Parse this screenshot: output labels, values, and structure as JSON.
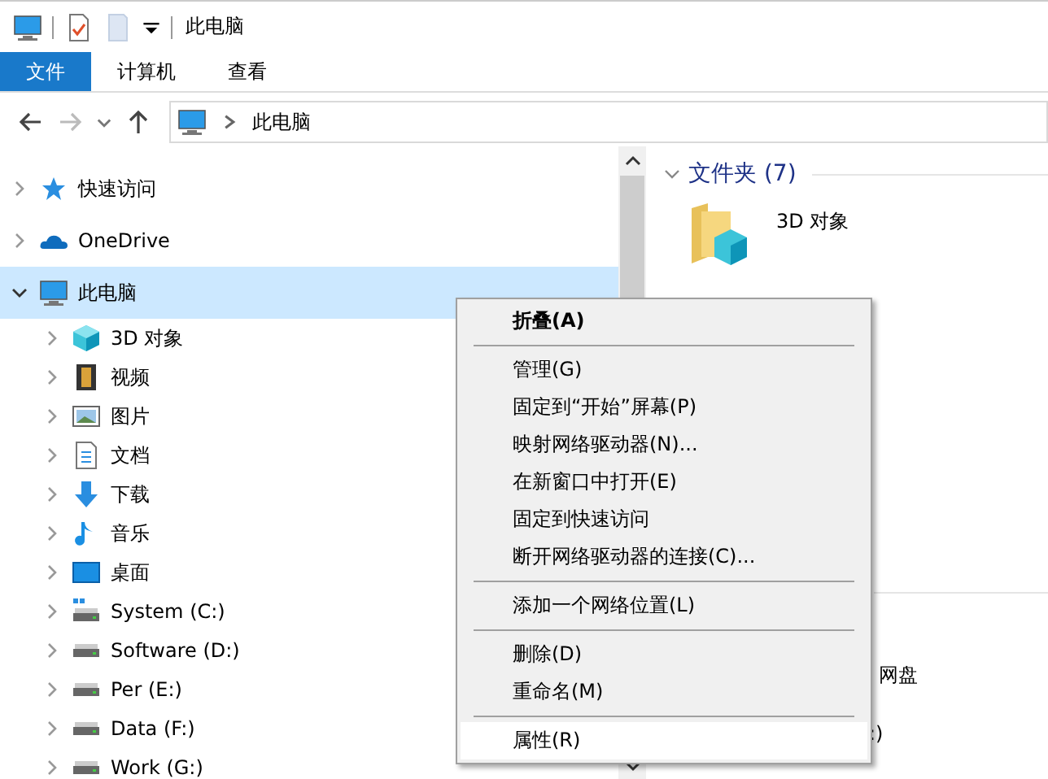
{
  "window": {
    "title": "此电脑"
  },
  "ribbon_tabs": [
    {
      "label": "文件",
      "selected": true
    },
    {
      "label": "计算机",
      "selected": false
    },
    {
      "label": "查看",
      "selected": false
    }
  ],
  "address": {
    "path": "此电脑"
  },
  "nav_tree": [
    {
      "label": "快速访问",
      "kind": "star",
      "expanded": false,
      "selected": false
    },
    {
      "label": "OneDrive",
      "kind": "cloud",
      "expanded": false,
      "selected": false
    },
    {
      "label": "此电脑",
      "kind": "pc",
      "expanded": true,
      "selected": true,
      "children": [
        {
          "label": "3D 对象",
          "kind": "cube",
          "expanded": false,
          "selected": false
        },
        {
          "label": "视频",
          "kind": "film",
          "expanded": false,
          "selected": false
        },
        {
          "label": "图片",
          "kind": "image",
          "expanded": false,
          "selected": false
        },
        {
          "label": "文档",
          "kind": "doc",
          "expanded": false,
          "selected": false
        },
        {
          "label": "下载",
          "kind": "download",
          "expanded": false,
          "selected": false
        },
        {
          "label": "音乐",
          "kind": "music",
          "expanded": false,
          "selected": false
        },
        {
          "label": "桌面",
          "kind": "desktop",
          "expanded": false,
          "selected": false
        },
        {
          "label": "System (C:)",
          "kind": "sysdrive",
          "expanded": false,
          "selected": false
        },
        {
          "label": "Software (D:)",
          "kind": "drive",
          "expanded": false,
          "selected": false
        },
        {
          "label": "Per (E:)",
          "kind": "drive",
          "expanded": false,
          "selected": false
        },
        {
          "label": "Data (F:)",
          "kind": "drive",
          "expanded": false,
          "selected": false
        },
        {
          "label": "Work (G:)",
          "kind": "drive",
          "expanded": false,
          "selected": false
        }
      ]
    }
  ],
  "content": {
    "group_title": "文件夹 (7)",
    "items": [
      {
        "label": "3D 对象"
      }
    ],
    "partial_texts": [
      "网盘",
      ":)"
    ]
  },
  "context_menu": [
    {
      "kind": "item",
      "label": "折叠(A)",
      "bold": true,
      "selected": false
    },
    {
      "kind": "separator"
    },
    {
      "kind": "item",
      "label": "管理(G)",
      "bold": false,
      "selected": false
    },
    {
      "kind": "item",
      "label": "固定到“开始”屏幕(P)",
      "bold": false,
      "selected": false
    },
    {
      "kind": "item",
      "label": "映射网络驱动器(N)...",
      "bold": false,
      "selected": false
    },
    {
      "kind": "item",
      "label": "在新窗口中打开(E)",
      "bold": false,
      "selected": false
    },
    {
      "kind": "item",
      "label": "固定到快速访问",
      "bold": false,
      "selected": false
    },
    {
      "kind": "item",
      "label": "断开网络驱动器的连接(C)...",
      "bold": false,
      "selected": false
    },
    {
      "kind": "separator"
    },
    {
      "kind": "item",
      "label": "添加一个网络位置(L)",
      "bold": false,
      "selected": false
    },
    {
      "kind": "separator"
    },
    {
      "kind": "item",
      "label": "删除(D)",
      "bold": false,
      "selected": false
    },
    {
      "kind": "item",
      "label": "重命名(M)",
      "bold": false,
      "selected": false
    },
    {
      "kind": "separator"
    },
    {
      "kind": "item",
      "label": "属性(R)",
      "bold": false,
      "selected": true
    }
  ]
}
